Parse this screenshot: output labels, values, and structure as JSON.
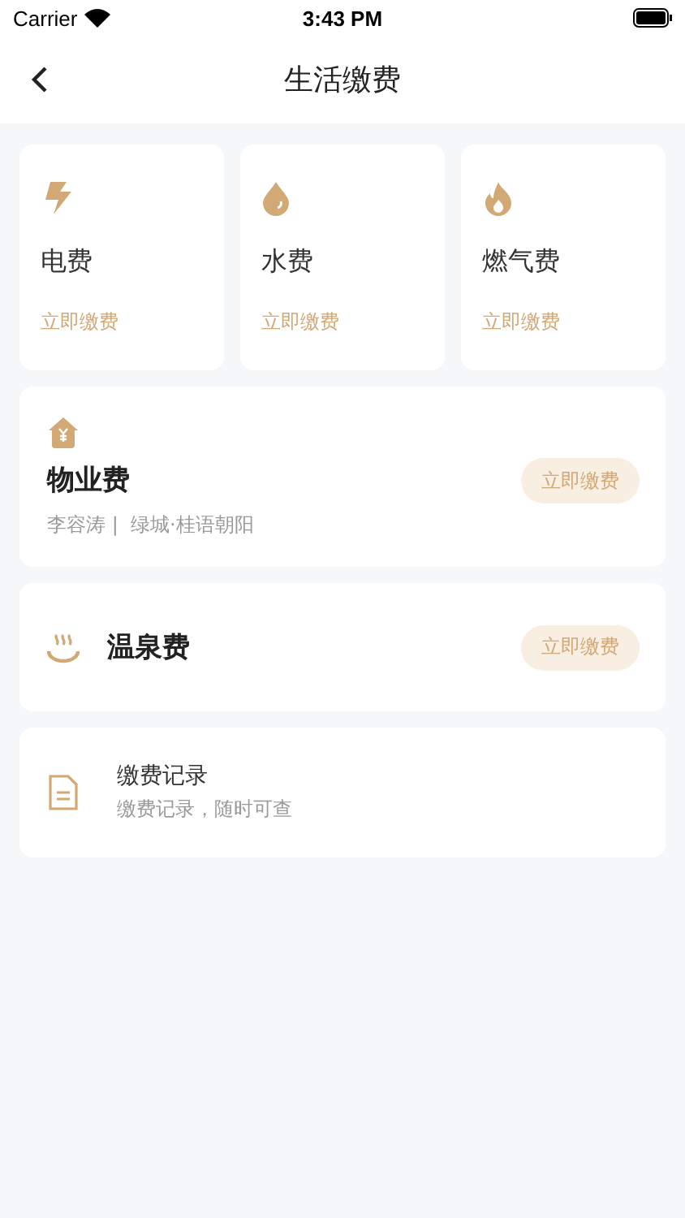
{
  "status_bar": {
    "carrier": "Carrier",
    "time": "3:43 PM"
  },
  "nav": {
    "title": "生活缴费"
  },
  "utilities": [
    {
      "kind": "electric",
      "name": "电费",
      "action": "立即缴费"
    },
    {
      "kind": "water",
      "name": "水费",
      "action": "立即缴费"
    },
    {
      "kind": "gas",
      "name": "燃气费",
      "action": "立即缴费"
    }
  ],
  "property": {
    "title": "物业费",
    "subtitle": "李容涛 |  绿城·桂语朝阳",
    "action": "立即缴费"
  },
  "hot_spring": {
    "title": "温泉费",
    "action": "立即缴费"
  },
  "records": {
    "title": "缴费记录",
    "subtitle": "缴费记录，随时可查"
  }
}
